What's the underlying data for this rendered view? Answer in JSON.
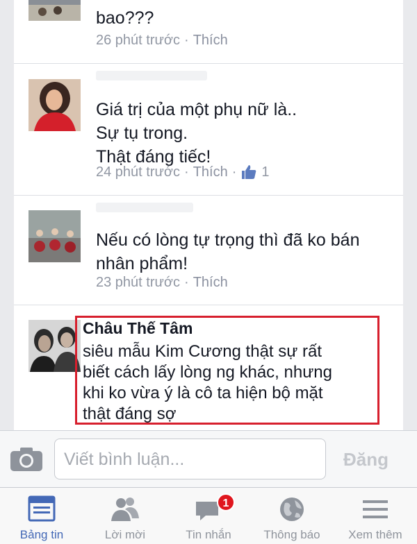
{
  "comments": [
    {
      "text": "bao???",
      "time": "26 phút trước",
      "like_label": "Thích"
    },
    {
      "text": "Giá trị của một phụ nữ là..\nSự tụ trong.\nThật đáng tiếc!",
      "time": "24 phút trước",
      "like_label": "Thích",
      "like_count": "1"
    },
    {
      "text": "Nếu có lòng tự trọng thì đã ko bán\nnhân phẩm!",
      "time": "23 phút trước",
      "like_label": "Thích"
    },
    {
      "author": "Châu Thế Tâm",
      "text": "siêu mẫu Kim Cương thật sự rất\nbiết cách lấy lòng ng khác, nhưng\nkhi ko vừa ý là cô ta hiện bộ mặt\nthật đáng sợ"
    }
  ],
  "separator": "·",
  "composer": {
    "placeholder": "Viết bình luận...",
    "post_label": "Đăng"
  },
  "tabs": [
    {
      "label": "Bảng tin",
      "icon": "news-feed-icon",
      "active": true
    },
    {
      "label": "Lời mời",
      "icon": "friend-requests-icon"
    },
    {
      "label": "Tin nhắn",
      "icon": "messages-icon",
      "badge": "1"
    },
    {
      "label": "Thông báo",
      "icon": "globe-notifications-icon"
    },
    {
      "label": "Xem thêm",
      "icon": "menu-icon"
    }
  ],
  "colors": {
    "highlight_border": "#d71f2d",
    "active_tab": "#4368b6",
    "badge": "#e0161e"
  }
}
